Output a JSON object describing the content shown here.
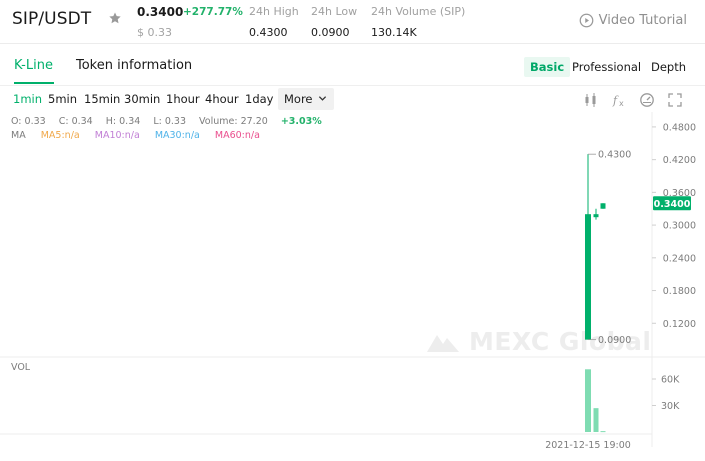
{
  "header": {
    "pair": "SIP/USDT",
    "favorite_icon": "star-icon",
    "price": "0.3400",
    "change_pct": "+277.77%",
    "fiat": "$ 0.33",
    "high_label": "24h High",
    "high_value": "0.4300",
    "low_label": "24h Low",
    "low_value": "0.0900",
    "volume_label": "24h Volume (SIP)",
    "volume_value": "130.14K",
    "video_label": "Video Tutorial",
    "video_icon": "play-circle-icon"
  },
  "tabs": {
    "kline": "K-Line",
    "token_info": "Token information",
    "basic": "Basic",
    "professional": "Professional",
    "depth": "Depth"
  },
  "intervals": {
    "items": [
      "1min",
      "5min",
      "15min",
      "30min",
      "1hour",
      "4hour",
      "1day"
    ],
    "active": "1min",
    "more": "More",
    "tools": [
      "candle-type-icon",
      "indicator-fx-icon",
      "settings-gauge-icon",
      "fullscreen-icon"
    ]
  },
  "legend": {
    "open": "O: 0.33",
    "close": "C: 0.34",
    "high": "H: 0.34",
    "low": "L: 0.33",
    "volume": "Volume: 27.20",
    "change": "+3.03%",
    "ma": "MA",
    "ma5": "MA5:n/a",
    "ma10": "MA10:n/a",
    "ma30": "MA30:n/a",
    "ma60": "MA60:n/a"
  },
  "colors": {
    "up": "#00b06b",
    "vol": "#7fdcb2",
    "ma5": "#f0a84a",
    "ma10": "#c17fd5",
    "ma30": "#4fb3e8",
    "ma60": "#ea4f8e"
  },
  "chart_data": {
    "type": "candlestick",
    "price_axis_ticks": [
      "0.4800",
      "0.4200",
      "0.3600",
      "0.3000",
      "0.2400",
      "0.1800",
      "0.1200"
    ],
    "ylim": [
      0.06,
      0.5
    ],
    "last_price_tag": "0.3400",
    "max_marker": "0.4300",
    "min_marker": "0.0900",
    "volume_label": "VOL",
    "volume_ticks": [
      "60K",
      "30K"
    ],
    "volume_ylim": [
      0,
      77000
    ],
    "time_label": "2021-12-15 19:00",
    "candles": [
      {
        "open": 0.09,
        "high": 0.43,
        "low": 0.09,
        "close": 0.32,
        "volume": 71000
      },
      {
        "open": 0.32,
        "high": 0.33,
        "low": 0.31,
        "close": 0.32,
        "volume": 27000
      },
      {
        "open": 0.33,
        "high": 0.34,
        "low": 0.33,
        "close": 0.34,
        "volume": 1000
      }
    ]
  },
  "watermark": "MEXC Global"
}
